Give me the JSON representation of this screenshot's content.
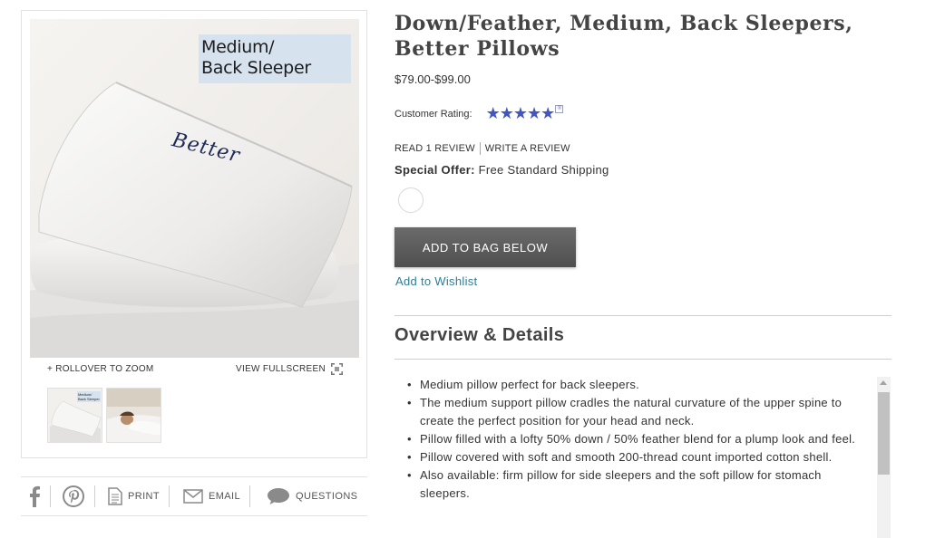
{
  "gallery": {
    "image_label_line1": "Medium/",
    "image_label_line2": "Back Sleeper",
    "pillow_print": "Better",
    "zoom_hint": "+ ROLLOVER TO ZOOM",
    "fullscreen_label": "VIEW FULLSCREEN",
    "thumb_label": "Medium/ Back Sleeper"
  },
  "share": {
    "facebook_icon": "facebook-icon",
    "pinterest_icon": "pinterest-icon",
    "print_label": "PRINT",
    "email_label": "EMAIL",
    "questions_label": "QUESTIONS"
  },
  "product": {
    "title": "Down/Feather, Medium, Back Sleepers, Better Pillows",
    "price": "$79.00-$99.00",
    "rating_label": "Customer Rating:",
    "rating_stars": "★★★★★",
    "rating_value": 5,
    "rating_info_icon": "®",
    "read_review": "READ 1 REVIEW",
    "write_review": "WRITE A REVIEW",
    "special_offer_label": "Special Offer:",
    "special_offer_text": "Free Standard Shipping",
    "add_to_bag": "ADD TO BAG BELOW",
    "wishlist": "Add to Wishlist"
  },
  "overview": {
    "title": "Overview & Details",
    "details": [
      "Medium pillow perfect for back sleepers.",
      "The medium support pillow cradles the natural curvature of the upper spine to create the perfect position for your head and neck.",
      "Pillow filled with a lofty  50% down / 50% feather blend  for a plump look and feel.",
      "Pillow covered with soft and smooth 200-thread count imported cotton shell.",
      "Also available: firm pillow for side sleepers and the soft pillow for stomach sleepers."
    ]
  },
  "colors": {
    "star": "#4356c0",
    "button": "#595959",
    "link": "#2e7d95",
    "label_bg": "#d6e2ee"
  }
}
